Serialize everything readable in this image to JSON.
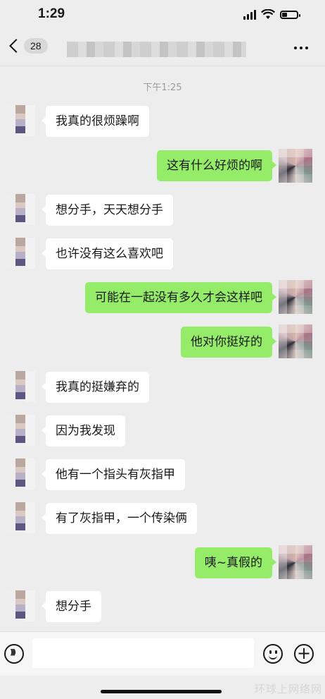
{
  "status_bar": {
    "time": "1:29",
    "battery_level": 0.3
  },
  "nav": {
    "back_icon": "chevron-left-icon",
    "unread_count": "28",
    "more_icon": "more-dots-icon"
  },
  "timestamp": "下午1:25",
  "messages": [
    {
      "side": "left",
      "text": "我真的很烦躁啊"
    },
    {
      "side": "right",
      "text": "这有什么好烦的啊"
    },
    {
      "side": "left",
      "text": "想分手，天天想分手"
    },
    {
      "side": "left",
      "text": "也许没有这么喜欢吧"
    },
    {
      "side": "right",
      "text": "可能在一起没有多久才会这样吧"
    },
    {
      "side": "right",
      "text": "他对你挺好的"
    },
    {
      "side": "left",
      "text": "我真的挺嫌弃的"
    },
    {
      "side": "left",
      "text": "因为我发现"
    },
    {
      "side": "left",
      "text": "他有一个指头有灰指甲"
    },
    {
      "side": "left",
      "text": "有了灰指甲，一个传染俩"
    },
    {
      "side": "right",
      "text": "咦~真假的"
    },
    {
      "side": "left",
      "text": "想分手"
    }
  ],
  "input_bar": {
    "voice_icon": "voice-icon",
    "emoji_icon": "emoji-icon",
    "plus_icon": "plus-icon",
    "input_value": ""
  },
  "watermark": "环球上网络网",
  "colors": {
    "background": "#ededed",
    "sent_bubble": "#95ec69",
    "received_bubble": "#ffffff"
  }
}
